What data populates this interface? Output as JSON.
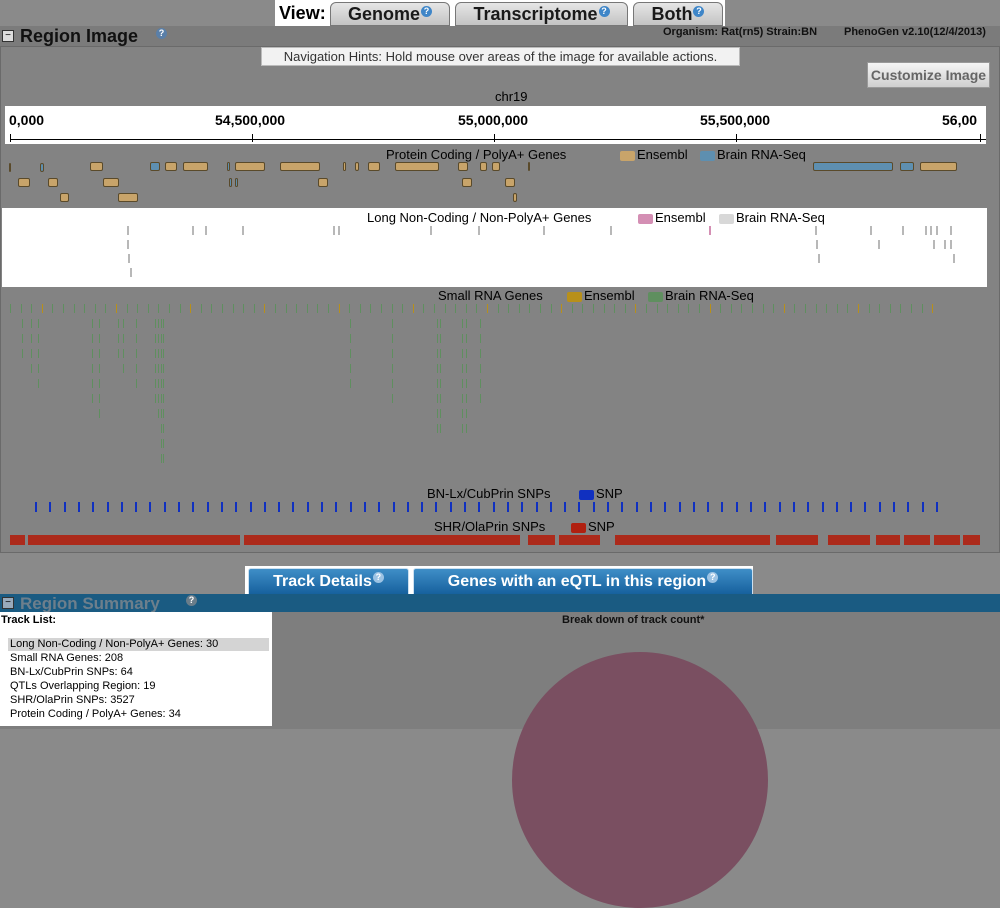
{
  "view": {
    "label": "View:",
    "tabs": [
      {
        "label": "Genome"
      },
      {
        "label": "Transcriptome"
      },
      {
        "label": "Both"
      }
    ]
  },
  "region_image": {
    "title": "Region Image",
    "organism_info": "Organism: Rat(rn5) Strain:BN",
    "version": "PhenoGen v2.10(12/4/2013)",
    "hint": "Navigation Hints: Hold mouse over areas of the image for available actions.",
    "customize_label": "Customize Image",
    "chromosome": "chr19",
    "ruler_ticks": [
      "0,000",
      "54,500,000",
      "55,000,000",
      "55,500,000",
      "56,00"
    ],
    "tracks": {
      "protein_coding": {
        "title": "Protein Coding / PolyA+ Genes",
        "legend": [
          "Ensembl",
          "Brain RNA-Seq"
        ]
      },
      "long_noncoding": {
        "title": "Long Non-Coding / Non-PolyA+ Genes",
        "legend": [
          "Ensembl",
          "Brain RNA-Seq"
        ]
      },
      "small_rna": {
        "title": "Small RNA Genes",
        "legend": [
          "Ensembl",
          "Brain RNA-Seq"
        ]
      },
      "bn_snps": {
        "title": "BN-Lx/CubPrin SNPs",
        "legend": [
          "SNP"
        ]
      },
      "shr_snps": {
        "title": "SHR/OlaPrin SNPs",
        "legend": [
          "SNP"
        ]
      }
    },
    "colors": {
      "ensembl_protein": "#c8a46a",
      "brain_protein": "#5e8fb0",
      "ensembl_lnc": "#d48fb4",
      "brain_lnc": "#d8d8d8",
      "ensembl_small": "#b8901a",
      "brain_small": "#5f8f5f",
      "bn_snp": "#1030c0",
      "shr_snp": "#b02010"
    }
  },
  "bottom_tabs": [
    {
      "label": "Track Details"
    },
    {
      "label": "Genes with an eQTL in this region"
    }
  ],
  "region_summary": {
    "title": "Region Summary",
    "track_list_label": "Track List:",
    "chart_title": "Break down of track count*",
    "track_list": [
      "Long Non-Coding / Non-PolyA+ Genes: 30",
      "Small RNA Genes: 208",
      "BN-Lx/CubPrin SNPs: 64",
      "QTLs Overlapping Region: 19",
      "SHR/OlaPrin SNPs: 3527",
      "Protein Coding / PolyA+ Genes: 34"
    ]
  }
}
